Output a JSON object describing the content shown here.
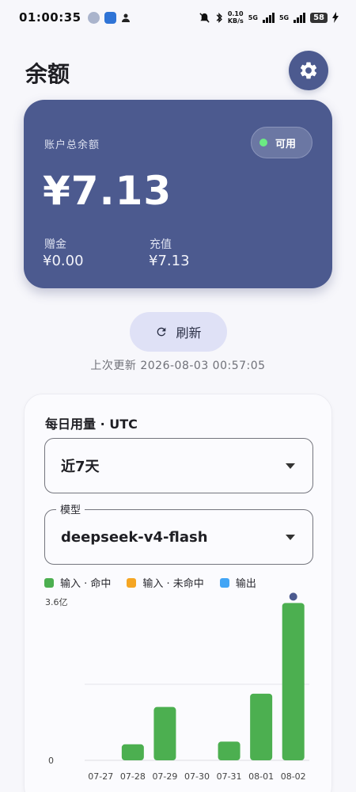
{
  "status_bar": {
    "time": "01:00:35",
    "net_speed": "0.10\nKB/s",
    "net1": "5G",
    "net2": "5G",
    "battery": "58"
  },
  "header": {
    "title": "余额"
  },
  "balance": {
    "label": "账户总余额",
    "status": "可用",
    "amount": "¥7.13",
    "bonus_label": "赠金",
    "bonus_value": "¥0.00",
    "topup_label": "充值",
    "topup_value": "¥7.13"
  },
  "refresh": {
    "label": "刷新",
    "last_updated": "上次更新 2026-08-03 00:57:05"
  },
  "usage": {
    "title": "每日用量 · UTC",
    "range_value": "近7天",
    "model_label": "模型",
    "model_value": "deepseek-v4-flash"
  },
  "chart_data": {
    "type": "bar",
    "categories": [
      "07-27",
      "07-28",
      "07-29",
      "07-30",
      "07-31",
      "08-01",
      "08-02"
    ],
    "series": [
      {
        "name": "输入 · 命中",
        "values": [
          0,
          0.6,
          2.0,
          0,
          0.7,
          2.5,
          5.9
        ]
      },
      {
        "name": "输入 · 未命中",
        "values": [
          0,
          0,
          0,
          0,
          0,
          0,
          0
        ]
      },
      {
        "name": "输出",
        "values": [
          0,
          0,
          0,
          0,
          0,
          0,
          0
        ]
      }
    ],
    "colors": [
      "#4caf50",
      "#f5a623",
      "#42a5f5"
    ],
    "y_tick_labels": [
      "0",
      "3.6亿"
    ],
    "ylim": [
      0,
      6
    ],
    "highlight_index": 6,
    "grid": true
  }
}
